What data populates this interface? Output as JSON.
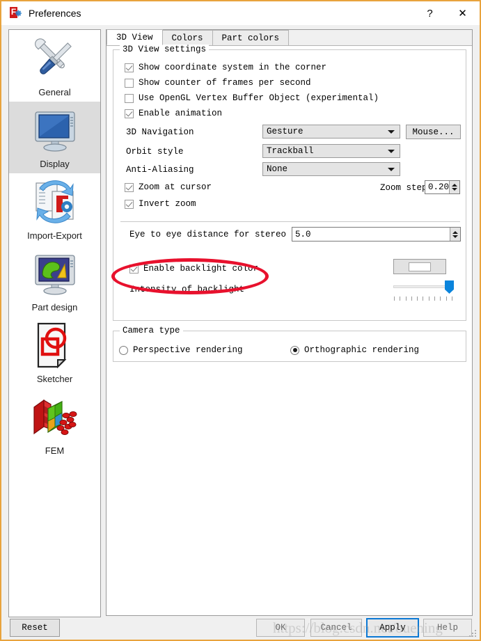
{
  "window": {
    "title": "Preferences",
    "app_icon": "freecad-icon",
    "help_button": "?",
    "close_button": "✕"
  },
  "sidebar": {
    "items": [
      {
        "label": "General",
        "icon": "wrench-screwdriver-icon",
        "selected": false
      },
      {
        "label": "Display",
        "icon": "monitor-icon",
        "selected": true
      },
      {
        "label": "Import-Export",
        "icon": "import-export-icon",
        "selected": false
      },
      {
        "label": "Part design",
        "icon": "part-design-icon",
        "selected": false
      },
      {
        "label": "Sketcher",
        "icon": "sketcher-icon",
        "selected": false
      },
      {
        "label": "FEM",
        "icon": "fem-mesh-icon",
        "selected": false
      }
    ]
  },
  "tabs": [
    {
      "label": "3D View",
      "active": true
    },
    {
      "label": "Colors",
      "active": false
    },
    {
      "label": "Part colors",
      "active": false
    }
  ],
  "view_settings": {
    "group_title": "3D View settings",
    "checkboxes": [
      {
        "label": "Show coordinate system in the corner",
        "checked": true
      },
      {
        "label": "Show counter of frames per second",
        "checked": false
      },
      {
        "label": "Use OpenGL Vertex Buffer Object (experimental)",
        "checked": false
      },
      {
        "label": "Enable animation",
        "checked": true
      }
    ],
    "fields": [
      {
        "label": "3D Navigation",
        "value": "Gesture"
      },
      {
        "label": "Orbit style",
        "value": "Trackball"
      },
      {
        "label": "Anti-Aliasing",
        "value": "None"
      }
    ],
    "mouse_button": "Mouse...",
    "zoom_at_cursor": {
      "label": "Zoom at cursor",
      "checked": true
    },
    "invert_zoom": {
      "label": "Invert zoom",
      "checked": true
    },
    "zoom_step": {
      "label": "Zoom step",
      "value": "0.20"
    },
    "eye_distance": {
      "label": "Eye to eye distance for stereo modes:",
      "value": "5.0"
    },
    "backlight": {
      "label": "Enable backlight color",
      "checked": true,
      "color": "#ffffff",
      "intensity_label": "Intensity of backlight",
      "intensity_percent": 100
    }
  },
  "camera_type": {
    "group_title": "Camera type",
    "options": [
      {
        "label": "Perspective rendering",
        "selected": false
      },
      {
        "label": "Orthographic rendering",
        "selected": true
      }
    ]
  },
  "buttons": {
    "reset": "Reset",
    "ok": "OK",
    "cancel": "Cancel",
    "apply": "Apply",
    "help": "Help"
  },
  "annotation": {
    "shape": "red-ellipse",
    "color": "#e8112d",
    "targets": "Enable backlight color"
  },
  "watermark": "https://blog.csdn.net/ouening",
  "colors": {
    "window_border": "#e8a33d",
    "accent_blue": "#0a78d4",
    "slider_blue": "#0a84dc",
    "annotation_red": "#e8112d"
  }
}
